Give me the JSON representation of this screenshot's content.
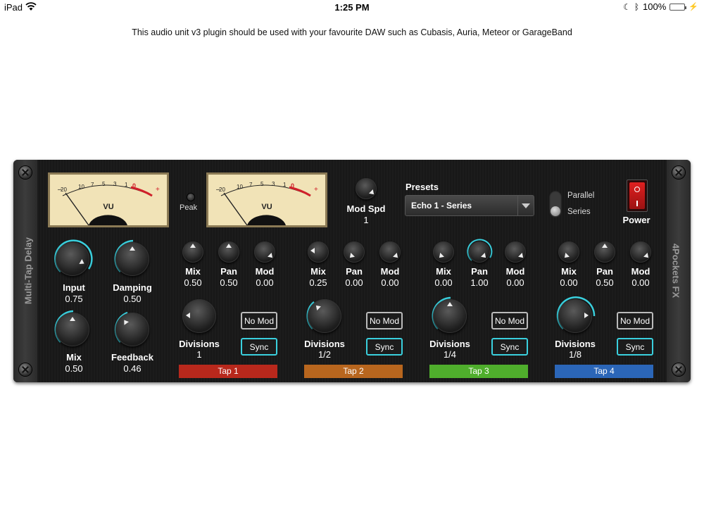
{
  "status_bar": {
    "device": "iPad",
    "time": "1:25 PM",
    "battery": "100%"
  },
  "description": "This audio unit v3 plugin should be used with your favourite DAW such as Cubasis, Auria, Meteor or GarageBand",
  "plugin": {
    "side_left": "Multi-Tap Delay",
    "side_right": "4Pockets FX",
    "vu_label": "VU",
    "vu_scale": [
      "–",
      "20",
      "10",
      "7",
      "5",
      "3",
      "1",
      "0",
      "1",
      "2",
      "3",
      "+"
    ],
    "peak_label": "Peak",
    "mod_spd": {
      "label": "Mod Spd",
      "value": "1"
    },
    "presets": {
      "label": "Presets",
      "selected": "Echo 1 - Series"
    },
    "routing": {
      "option1": "Parallel",
      "option2": "Series"
    },
    "power_label": "Power",
    "input": {
      "label": "Input",
      "value": "0.75"
    },
    "damping": {
      "label": "Damping",
      "value": "0.50"
    },
    "mix": {
      "label": "Mix",
      "value": "0.50"
    },
    "feedback": {
      "label": "Feedback",
      "value": "0.46"
    },
    "taps": [
      {
        "name": "Tap 1",
        "color": "#b8281c",
        "mix": "0.50",
        "pan": "0.50",
        "mod": "0.00",
        "divisions": "1",
        "mod_button": "No Mod",
        "sync_button": "Sync"
      },
      {
        "name": "Tap 2",
        "color": "#b8661e",
        "mix": "0.25",
        "pan": "0.00",
        "mod": "0.00",
        "divisions": "1/2",
        "mod_button": "No Mod",
        "sync_button": "Sync"
      },
      {
        "name": "Tap 3",
        "color": "#4fae2c",
        "mix": "0.00",
        "pan": "1.00",
        "mod": "0.00",
        "divisions": "1/4",
        "mod_button": "No Mod",
        "sync_button": "Sync"
      },
      {
        "name": "Tap 4",
        "color": "#2b66b8",
        "mix": "0.00",
        "pan": "0.50",
        "mod": "0.00",
        "divisions": "1/8",
        "mod_button": "No Mod",
        "sync_button": "Sync"
      }
    ],
    "knob_labels": {
      "mix": "Mix",
      "pan": "Pan",
      "mod": "Mod",
      "divisions": "Divisions"
    }
  }
}
